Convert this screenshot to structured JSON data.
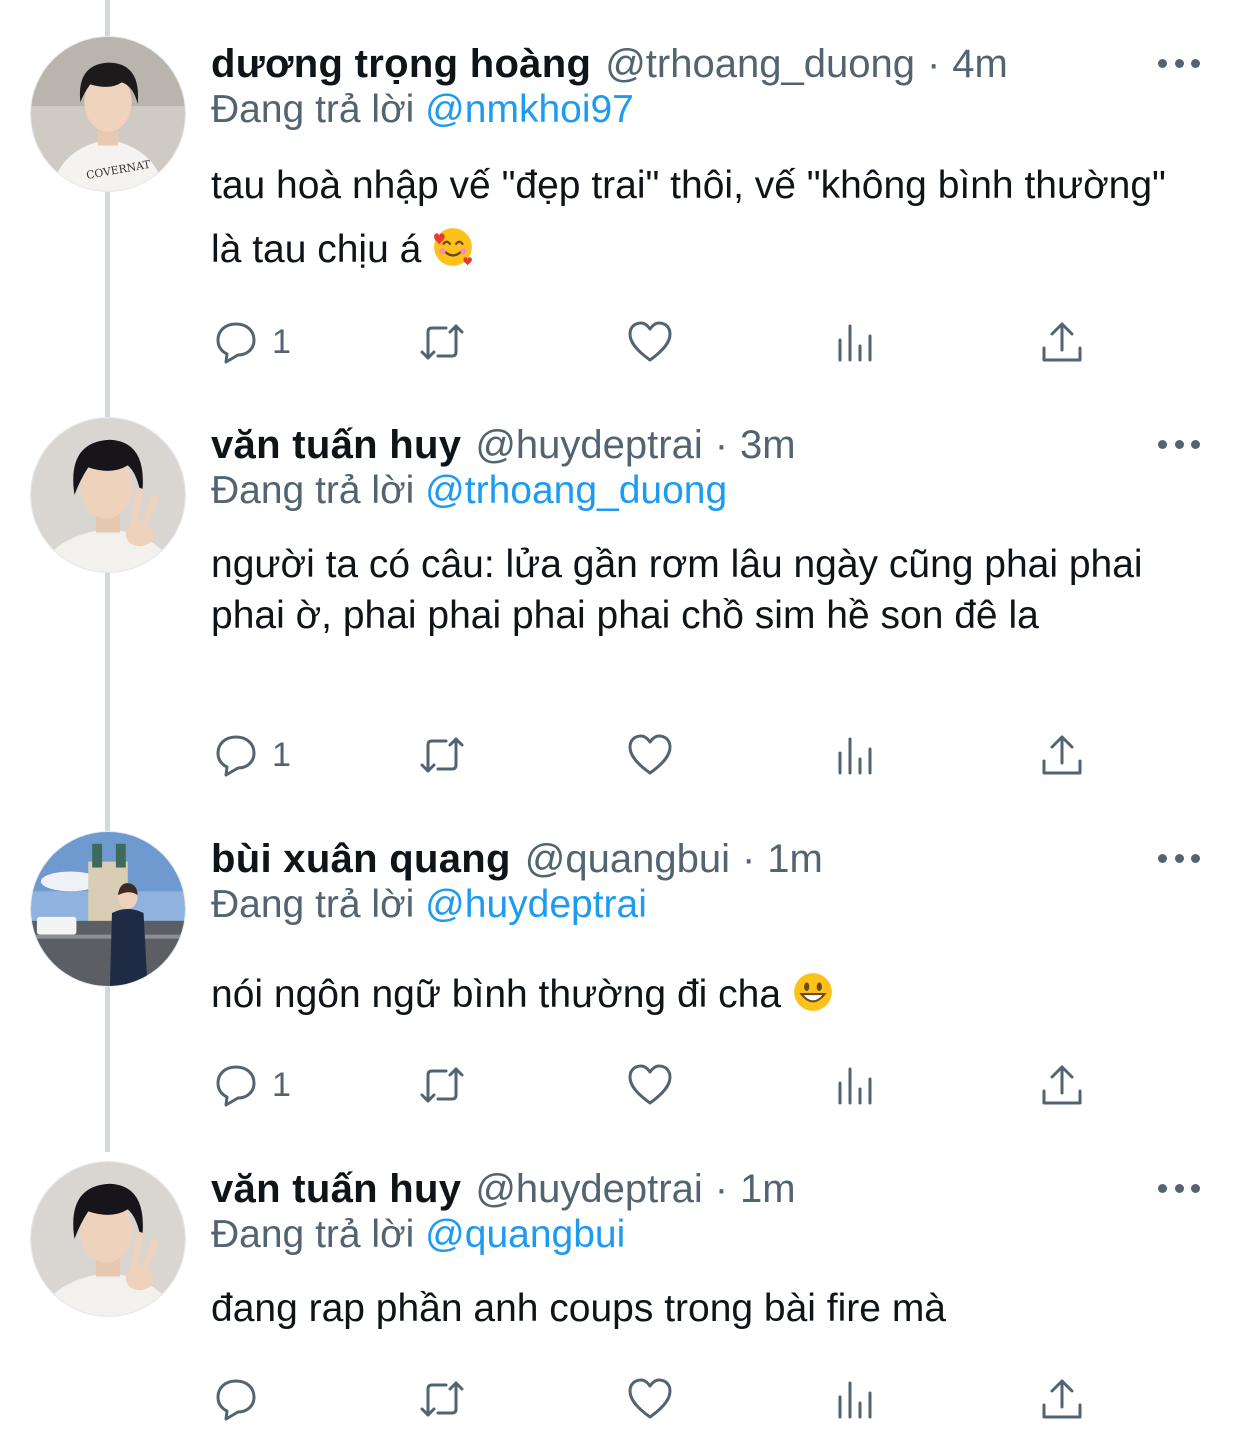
{
  "reply_label": "Đang trả lời",
  "tweets": [
    {
      "name": "dương trọng hoàng",
      "handle": "@trhoang_duong",
      "separator": "·",
      "time": "4m",
      "reply_to": "@nmkhoi97",
      "text": "tau hoà nhập vế \"đẹp trai\" thôi, vế \"không bình thường\" là tau chịu á",
      "emoji": "smiling-face-with-hearts",
      "reply_count": "1",
      "avatar": "young man with dark hair in white COVERNAT t-shirt"
    },
    {
      "name": "văn tuấn huy",
      "handle": "@huydeptrai",
      "separator": "·",
      "time": "3m",
      "reply_to": "@trhoang_duong",
      "text": "người ta có câu: lửa gần rơm lâu ngày cũng phai phai phai ờ, phai phai phai phai chồ sim hề son đê la",
      "emoji": "",
      "reply_count": "1",
      "avatar": "young man with dark hair making peace sign"
    },
    {
      "name": "bùi xuân quang",
      "handle": "@quangbui",
      "separator": "·",
      "time": "1m",
      "reply_to": "@huydeptrai",
      "text": "nói ngôn ngữ bình thường đi cha",
      "emoji": "grinning-face",
      "reply_count": "1",
      "avatar": "young man standing in front of church towers"
    },
    {
      "name": "văn tuấn huy",
      "handle": "@huydeptrai",
      "separator": "·",
      "time": "1m",
      "reply_to": "@quangbui",
      "text": "đang rap phần anh coups trong bài fire mà",
      "emoji": "",
      "reply_count": "",
      "avatar": "young man with dark hair making peace sign"
    }
  ],
  "colors": {
    "text": "#0f1419",
    "secondary": "#536471",
    "link": "#1d9bf0",
    "thread_line": "#cfd9de"
  }
}
